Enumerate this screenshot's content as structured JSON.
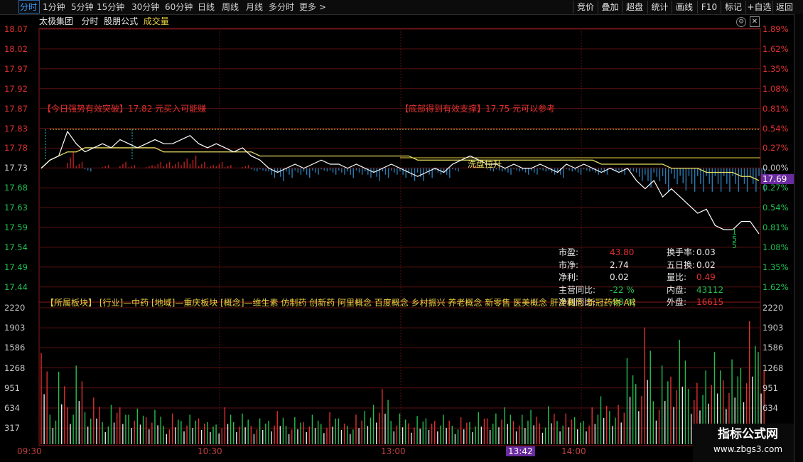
{
  "toolbar": {
    "periods": [
      "分时",
      "1分钟",
      "5分钟",
      "15分钟",
      "30分钟",
      "60分钟",
      "日线",
      "周线",
      "月线",
      "多分时",
      "更多 >"
    ],
    "active_index": 0,
    "right_buttons": [
      "竞价",
      "叠加",
      "超盘",
      "统计",
      "画线",
      "F10",
      "标记",
      "+自选",
      "返回"
    ]
  },
  "info": {
    "stock_name": "太极集团",
    "mode": "分时",
    "formula": "股朋公式",
    "volume_label": "成交量"
  },
  "price_axis": {
    "left": [
      "18.07",
      "18.02",
      "17.97",
      "17.92",
      "17.87",
      "17.83",
      "17.78",
      "17.73",
      "17.68",
      "17.63",
      "17.59",
      "17.54",
      "17.49",
      "17.44"
    ],
    "right": [
      "1.89%",
      "1.62%",
      "1.35%",
      "1.08%",
      "0.81%",
      "0.54%",
      "0.27%",
      "0.00%",
      "0.27%",
      "0.54%",
      "0.81%",
      "1.08%",
      "1.35%",
      "1.62%"
    ],
    "current_price": "17.69",
    "base_price": 17.73,
    "top_price": 18.07,
    "bottom_price": 17.44
  },
  "volume_axis": {
    "labels": [
      "2220",
      "1903",
      "1586",
      "1268",
      "951",
      "634",
      "317"
    ],
    "max": 2220
  },
  "time_axis": [
    "09:30",
    "10:30",
    "13:00",
    "13:42",
    "14:00"
  ],
  "annotations": {
    "strong": "【今日强势有效突破】17.82 元买入可能赚",
    "support": "【底部得到有效支撑】17.75 元可以参考",
    "wash": "洗盘拉升",
    "digits": [
      "1",
      "5",
      "5"
    ]
  },
  "sectors": "【所属板块】 [行业]—中药 [地域]—重庆板块 [概念]—维生素 仿制药 创新药 阿里概念 百度概念 乡村振兴 养老概念 新零售 医美概念 肝炎概念 新冠药物 AI智能体",
  "stats": [
    {
      "label": "市盈:",
      "value": "43.80",
      "color": "#e03030"
    },
    {
      "label": "市净:",
      "value": "2.74",
      "color": "#e8e8e8"
    },
    {
      "label": "净利:",
      "value": "0.02",
      "color": "#e8e8e8"
    },
    {
      "label": "主营同比:",
      "value": "-22 %",
      "color": "#20c050"
    },
    {
      "label": "净利同比:",
      "value": "-98 %",
      "color": "#20c050"
    }
  ],
  "stats_right": [
    {
      "label": "换手率:",
      "value": "0.03",
      "color": "#e8e8e8"
    },
    {
      "label": "五日换:",
      "value": "0.02",
      "color": "#e8e8e8"
    },
    {
      "label": "量比:",
      "value": "0.49",
      "color": "#e03030"
    },
    {
      "label": "内盘:",
      "value": "43112",
      "color": "#20c050"
    },
    {
      "label": "外盘:",
      "value": "16615",
      "color": "#e03030"
    }
  ],
  "watermark": {
    "title": "指标公式网",
    "url": "www.zbgs3.com"
  },
  "colors": {
    "up": "#e03030",
    "down": "#20c050",
    "price_line": "#ffffff",
    "avg_line": "#e8e060",
    "grid": "#5a1010",
    "accent": "#3aa0ff"
  },
  "chart_data": {
    "type": "line",
    "price_series": [
      17.73,
      17.75,
      17.76,
      17.82,
      17.79,
      17.77,
      17.78,
      17.79,
      17.78,
      17.8,
      17.79,
      17.78,
      17.79,
      17.8,
      17.79,
      17.79,
      17.8,
      17.81,
      17.79,
      17.78,
      17.79,
      17.78,
      17.77,
      17.78,
      17.76,
      17.75,
      17.73,
      17.72,
      17.73,
      17.74,
      17.73,
      17.74,
      17.75,
      17.74,
      17.74,
      17.73,
      17.74,
      17.73,
      17.72,
      17.73,
      17.74,
      17.73,
      17.72,
      17.71,
      17.72,
      17.73,
      17.72,
      17.74,
      17.75,
      17.76,
      17.75,
      17.74,
      17.74,
      17.73,
      17.74,
      17.73,
      17.73,
      17.74,
      17.73,
      17.72,
      17.74,
      17.73,
      17.74,
      17.73,
      17.72,
      17.73,
      17.72,
      17.73,
      17.7,
      17.68,
      17.7,
      17.66,
      17.68,
      17.66,
      17.64,
      17.62,
      17.63,
      17.59,
      17.58,
      17.58,
      17.6,
      17.6,
      17.57
    ],
    "avg_series": [
      17.73,
      17.75,
      17.76,
      17.77,
      17.77,
      17.78,
      17.78,
      17.78,
      17.78,
      17.78,
      17.78,
      17.78,
      17.78,
      17.78,
      17.77,
      17.77,
      17.77,
      17.77,
      17.77,
      17.77,
      17.77,
      17.77,
      17.77,
      17.77,
      17.77,
      17.76,
      17.76,
      17.76,
      17.76,
      17.76,
      17.76,
      17.76,
      17.76,
      17.76,
      17.76,
      17.76,
      17.76,
      17.76,
      17.76,
      17.76,
      17.76,
      17.76,
      17.76,
      17.75,
      17.75,
      17.75,
      17.75,
      17.75,
      17.75,
      17.75,
      17.75,
      17.75,
      17.75,
      17.75,
      17.75,
      17.75,
      17.75,
      17.75,
      17.75,
      17.75,
      17.75,
      17.75,
      17.75,
      17.75,
      17.74,
      17.74,
      17.74,
      17.74,
      17.74,
      17.74,
      17.74,
      17.74,
      17.73,
      17.73,
      17.73,
      17.73,
      17.72,
      17.72,
      17.72,
      17.72,
      17.71,
      17.71,
      17.7
    ],
    "volume_series": [
      1480,
      480,
      1180,
      600,
      1280,
      520,
      760,
      360,
      640,
      600,
      480,
      580,
      440,
      560,
      300,
      500,
      380,
      480,
      420,
      360,
      320,
      600,
      360,
      500,
      300,
      420,
      380,
      540,
      300,
      440,
      360,
      480,
      330,
      520,
      420,
      300,
      480,
      540,
      640,
      900,
      380,
      500,
      340,
      460,
      420,
      380,
      480,
      300,
      440,
      360,
      520,
      420,
      500,
      600,
      380,
      480,
      560,
      340,
      620,
      380,
      500,
      440,
      380,
      600,
      780,
      540,
      640,
      1400,
      980,
      1900,
      700,
      1280,
      1100,
      1700,
      900,
      1000,
      1200,
      1500,
      1040,
      1380,
      1240,
      2000,
      1500
    ],
    "ylim": [
      17.44,
      18.07
    ]
  }
}
